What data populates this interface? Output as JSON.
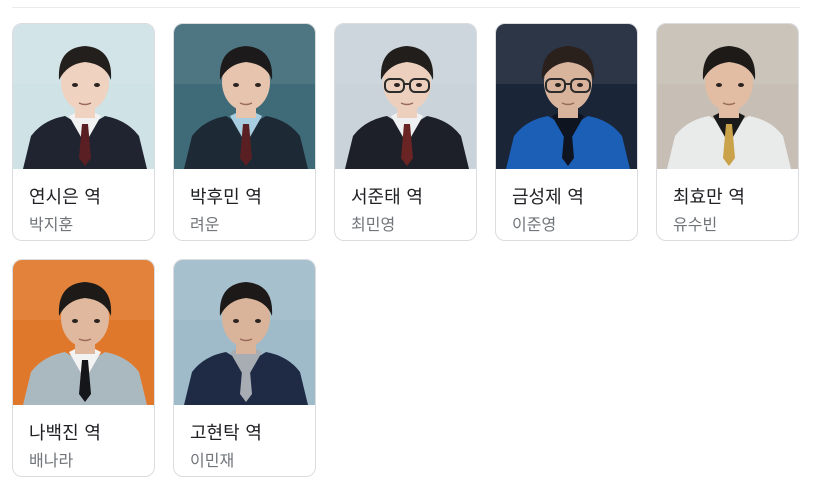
{
  "cast": [
    {
      "role": "연시은 역",
      "actor": "박지훈",
      "bg": "#cfe2e6",
      "suit": "#1f2430",
      "shirt": "#f2f2f2",
      "tie": "#5a1f22",
      "hair": "#231f1c",
      "skin": "#efd2c0",
      "glasses": false
    },
    {
      "role": "박후민 역",
      "actor": "려운",
      "bg": "#3f6b78",
      "suit": "#1d2a36",
      "shirt": "#a9cde0",
      "tie": "#5a1f22",
      "hair": "#1c1a1a",
      "skin": "#e6c4ae",
      "glasses": false
    },
    {
      "role": "서준태 역",
      "actor": "최민영",
      "bg": "#c9d3d9",
      "suit": "#1e2029",
      "shirt": "#eef0f2",
      "tie": "#6a2424",
      "hair": "#221e1c",
      "skin": "#ecd0bd",
      "glasses": true
    },
    {
      "role": "금성제 역",
      "actor": "이준영",
      "bg": "#1b2538",
      "suit": "#1b5fb6",
      "shirt": "#0e1420",
      "tie": "#0e1420",
      "hair": "#2a211c",
      "skin": "#d9b49d",
      "glasses": true
    },
    {
      "role": "최효만 역",
      "actor": "유수빈",
      "bg": "#c7bfb5",
      "suit": "#e9eaea",
      "shirt": "#1a1a1a",
      "tie": "#c9a24a",
      "hair": "#1d1a18",
      "skin": "#e2bca3",
      "glasses": false
    },
    {
      "role": "나백진 역",
      "actor": "배나라",
      "bg": "#e0782b",
      "suit": "#aab9c0",
      "shirt": "#f3f3f3",
      "tie": "#15161a",
      "hair": "#1d1a18",
      "skin": "#e0b89d",
      "glasses": false
    },
    {
      "role": "고현탁 역",
      "actor": "이민재",
      "bg": "#9fbbc9",
      "suit": "#1f2b45",
      "shirt": "#a8adb3",
      "tie": "#a8adb3",
      "hair": "#1c1918",
      "skin": "#d9b39a",
      "glasses": false
    }
  ]
}
